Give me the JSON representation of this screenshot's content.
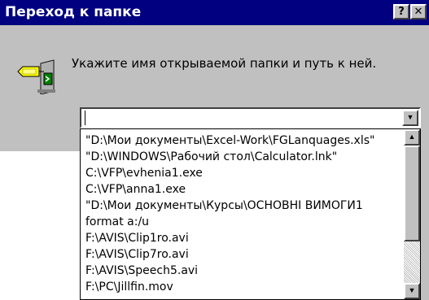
{
  "window": {
    "title": "Переход к папке",
    "help_button": "?",
    "close_button": "✕"
  },
  "prompt": {
    "text": "Укажите имя открываемой папки и путь к ней.",
    "icon": "go-to-folder-icon"
  },
  "combo": {
    "value": "",
    "arrow": "▼"
  },
  "dropdown": {
    "items": [
      "\"D:\\Мои документы\\Excel-Work\\FGLanquages.xls\"",
      "\"D:\\WINDOWS\\Рабочий стол\\Calculator.lnk\"",
      "C:\\VFP\\evhenia1.exe",
      "C:\\VFP\\anna1.exe",
      "\"D:\\Мои документы\\Курсы\\ОСНОВНІ ВИМОГИ1",
      "format a:/u",
      "F:\\AVIS\\Clip1ro.avi",
      "F:\\AVIS\\Clip7ro.avi",
      "F:\\AVIS\\Speech5.avi",
      "F:\\PC\\Jillfin.mov"
    ],
    "scroll_up": "▲",
    "scroll_down": "▼"
  },
  "colors": {
    "titlebar": "#000080",
    "face": "#c0c0c0"
  }
}
